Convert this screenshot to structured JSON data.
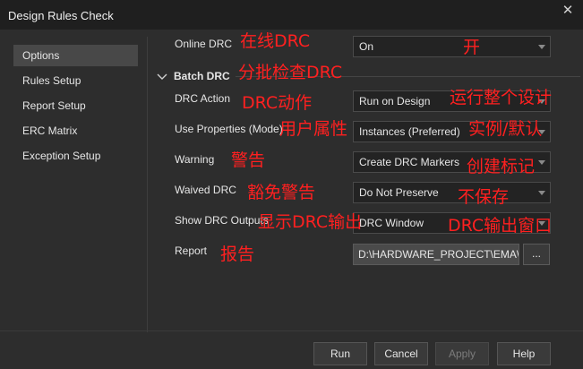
{
  "window": {
    "title": "Design Rules Check",
    "close_glyph": "✕"
  },
  "sidebar": {
    "items": [
      {
        "label": "Options",
        "selected": true
      },
      {
        "label": "Rules Setup"
      },
      {
        "label": "Report Setup"
      },
      {
        "label": "ERC Matrix"
      },
      {
        "label": "Exception Setup"
      }
    ]
  },
  "options": {
    "online_drc": {
      "label": "Online DRC",
      "value": "On"
    },
    "batch_drc": {
      "label": "Batch DRC"
    },
    "drc_action": {
      "label": "DRC Action",
      "value": "Run on Design"
    },
    "use_properties": {
      "label": "Use Properties (Mode)",
      "value": "Instances (Preferred)"
    },
    "warning": {
      "label": "Warning",
      "value": "Create DRC Markers"
    },
    "waived_drc": {
      "label": "Waived DRC",
      "value": "Do Not Preserve"
    },
    "show_outputs": {
      "label": "Show DRC Outputs",
      "value": "DRC Window"
    },
    "report": {
      "label": "Report",
      "value": "D:\\HARDWARE_PROJECT\\EMA\\",
      "browse_label": "..."
    }
  },
  "annotations": {
    "online_drc": "在线DRC",
    "on": "开",
    "batch_drc": "分批检查DRC",
    "drc_action": "DRC动作",
    "run_on_design": "运行整个设计",
    "use_properties": "用户属性",
    "instances": "实例/默认",
    "warning": "警告",
    "create_markers": "创建标记",
    "waived_drc": "豁免警告",
    "do_not_preserve": "不保存",
    "show_outputs": "显示DRC输出",
    "drc_window": "DRC输出窗口",
    "report": "报告"
  },
  "footer": {
    "run": "Run",
    "cancel": "Cancel",
    "apply": "Apply",
    "help": "Help"
  },
  "colors": {
    "annotation": "#ff2020",
    "background": "#2d2d2d",
    "titlebar": "#1f1f1f",
    "selected_nav": "#484848"
  },
  "icons": {
    "close": "close-icon",
    "collapse": "chevron-down-icon",
    "dropdown": "dropdown-arrow-icon"
  }
}
